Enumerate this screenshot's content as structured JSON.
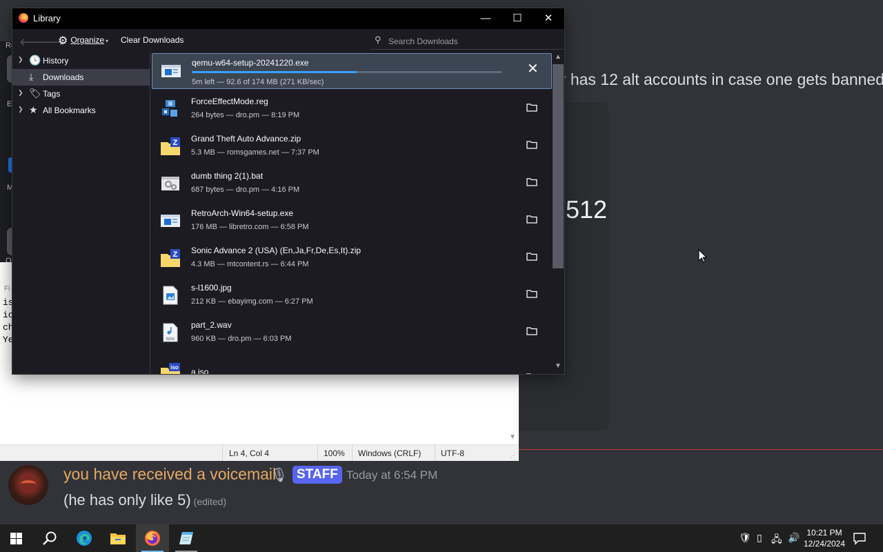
{
  "discord": {
    "top_text": "er has 12 alt accounts in case one gets banned",
    "embed_number": "512",
    "message": {
      "author": "you have received a voicemail",
      "badge": "STAFF",
      "timestamp": "Today at 6:54 PM",
      "body": "(he has only like 5)",
      "edited": "(edited)",
      "author_color": "#e6a862",
      "badge_color": "#5865f2"
    }
  },
  "left_fragment": {
    "lines": [
      "Re",
      "E",
      "M",
      "O",
      "Fi"
    ]
  },
  "notepad": {
    "text_lines": [
      "is",
      "ic",
      "ch",
      "Ye"
    ],
    "status": {
      "position": "Ln 4, Col 4",
      "zoom": "100%",
      "line_endings": "Windows (CRLF)",
      "encoding": "UTF-8"
    }
  },
  "library": {
    "title": "Library",
    "window_controls": {
      "minimize": "—",
      "maximize": "☐",
      "close": "✕"
    },
    "toolbar": {
      "organize": "Organize",
      "clear_downloads": "Clear Downloads",
      "search_placeholder": "Search Downloads"
    },
    "sidebar": [
      {
        "label": "History",
        "icon": "clock-icon",
        "expandable": true,
        "selected": false
      },
      {
        "label": "Downloads",
        "icon": "download-icon",
        "expandable": false,
        "selected": true
      },
      {
        "label": "Tags",
        "icon": "tag-icon",
        "expandable": true,
        "selected": false
      },
      {
        "label": "All Bookmarks",
        "icon": "star-icon",
        "expandable": true,
        "selected": false
      }
    ],
    "downloads": [
      {
        "name": "qemu-w64-setup-20241220.exe",
        "meta": "5m left — 92.6 of 174 MB (271 KB/sec)",
        "type": "exe",
        "in_progress": true,
        "progress": 0.53
      },
      {
        "name": "ForceEffectMode.reg",
        "meta": "264 bytes — dro.pm — 8:19 PM",
        "type": "reg"
      },
      {
        "name": "Grand Theft Auto Advance.zip",
        "meta": "5.3 MB — romsgames.net — 7:37 PM",
        "type": "zip"
      },
      {
        "name": "dumb thing 2(1).bat",
        "meta": "687 bytes — dro.pm — 4:16 PM",
        "type": "bat"
      },
      {
        "name": "RetroArch-Win64-setup.exe",
        "meta": "176 MB — libretro.com — 6:58 PM",
        "type": "exe"
      },
      {
        "name": "Sonic Advance 2 (USA) (En,Ja,Fr,De,Es,It).zip",
        "meta": "4.3 MB — mtcontent.rs — 6:44 PM",
        "type": "zip"
      },
      {
        "name": "s-l1600.jpg",
        "meta": "212 KB — ebayimg.com — 6:27 PM",
        "type": "jpg"
      },
      {
        "name": "part_2.wav",
        "meta": "960 KB — dro.pm — 6:03 PM",
        "type": "wav"
      },
      {
        "name": "a.iso",
        "meta": "",
        "type": "iso"
      }
    ]
  },
  "taskbar": {
    "apps": [
      "start-icon",
      "search-icon",
      "edge-icon",
      "file-explorer-icon",
      "firefox-icon",
      "notepad-icon"
    ],
    "active_app": "firefox-icon",
    "clock_time": "10:21 PM",
    "clock_date": "12/24/2024"
  }
}
